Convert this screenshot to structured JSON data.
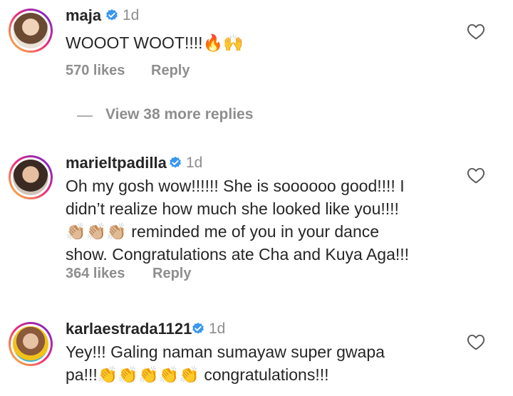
{
  "comments": [
    {
      "username": "maja",
      "time": "1d",
      "lines": [
        "WOOOT WOOT!!!!🔥🙌"
      ],
      "likes": "570 likes",
      "reply": "Reply"
    },
    {
      "username": "marieltpadilla",
      "time": "1d",
      "lines": [
        "Oh my gosh wow!!!!!! She is soooooo good!!!! I",
        "didn’t realize how much she looked like you!!!!",
        "👏🏼👏🏼👏🏼 reminded me of you in your dance",
        "show. Congratulations ate Cha and Kuya Aga!!!"
      ],
      "likes": "364 likes",
      "reply": "Reply"
    },
    {
      "username": "karlaestrada1121",
      "time": "1d",
      "lines": [
        "Yey!!! Galing naman sumayaw  super gwapa",
        "pa!!!👏👏👏👏👏 congratulations!!!"
      ]
    }
  ],
  "view_more": "View 38 more replies",
  "icons": {
    "verified": "verified-badge-icon",
    "like": "heart-icon"
  },
  "colors": {
    "verified": "#3897f0",
    "muted": "#8e8e8e",
    "text": "#262626"
  }
}
